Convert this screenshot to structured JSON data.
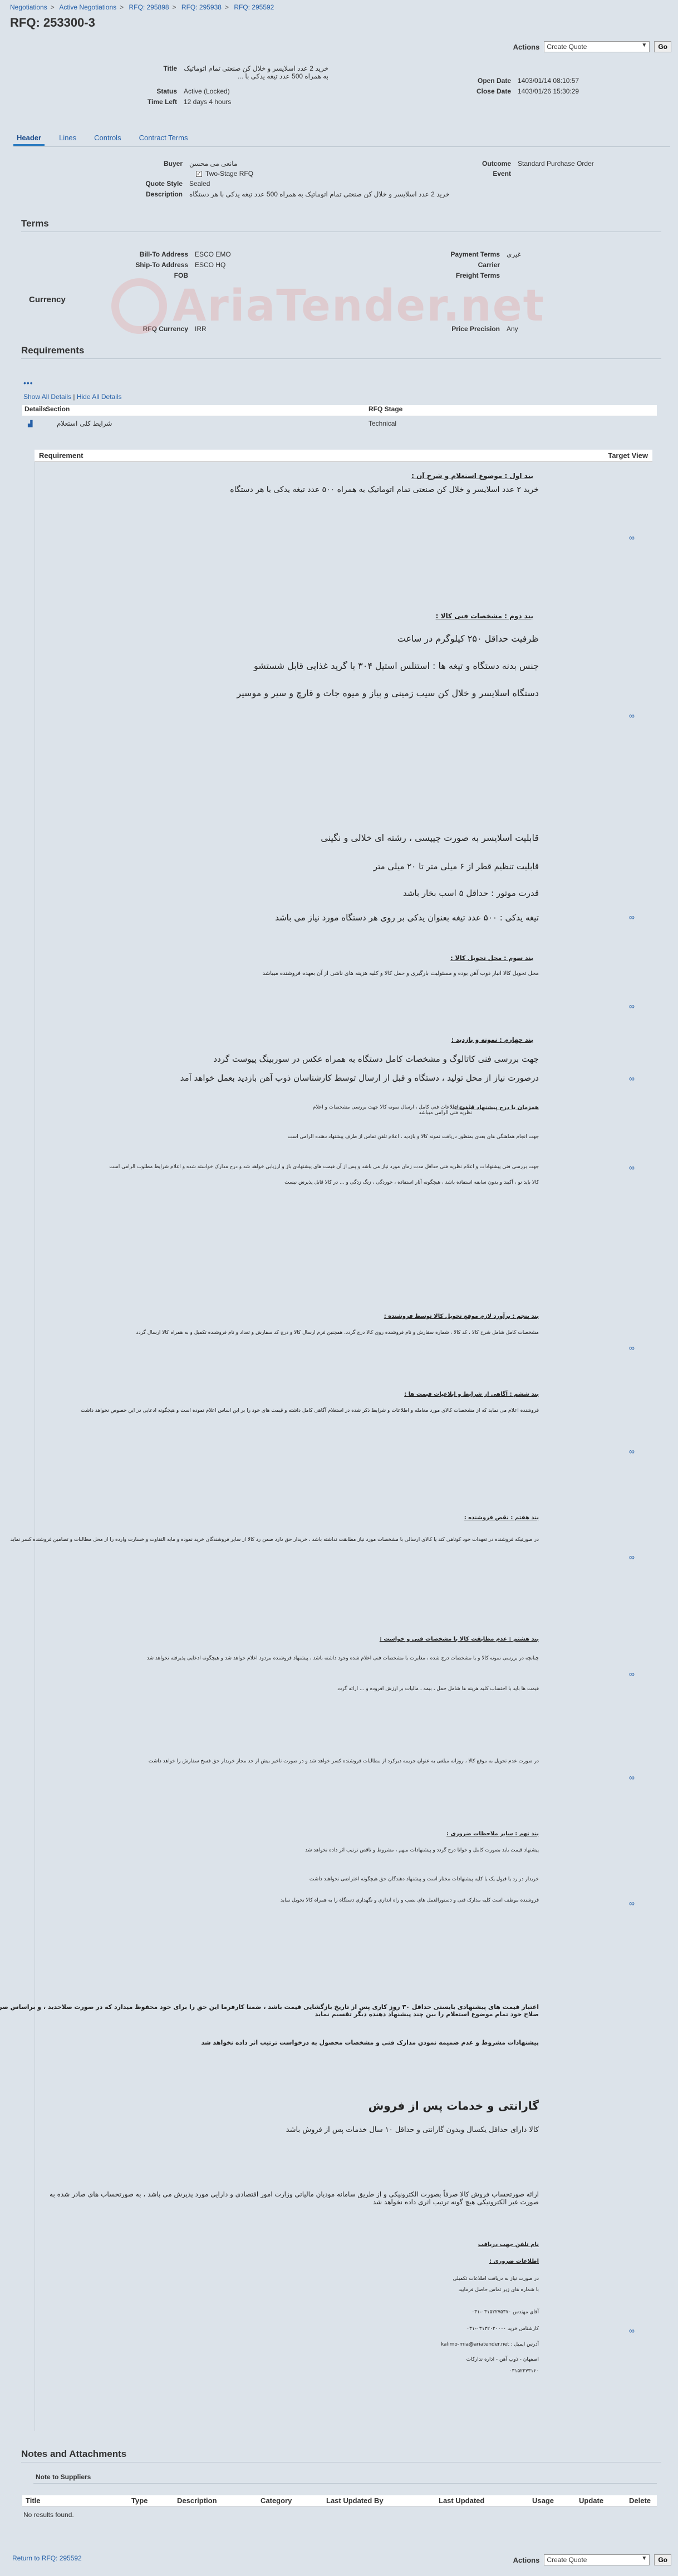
{
  "breadcrumb": [
    "Negotiations",
    "Active Negotiations",
    "RFQ: 295898",
    "RFQ: 295938",
    "RFQ: 295592"
  ],
  "page_title": "RFQ: 253300-3",
  "actions": {
    "label": "Actions",
    "selected": "Create Quote",
    "go": "Go"
  },
  "header": {
    "title_label": "Title",
    "title_value": "خرید 2 عدد اسلایسر و خلال کن صنعتی تمام اتوماتیک به همراه 500 عدد تیغه یدکی با ...",
    "status_label": "Status",
    "status_value": "Active (Locked)",
    "time_left_label": "Time Left",
    "time_left_value": "12 days 4 hours",
    "open_date_label": "Open Date",
    "open_date_value": "1403/01/14 08:10:57",
    "close_date_label": "Close Date",
    "close_date_value": "1403/01/26 15:30:29"
  },
  "tabs": [
    "Header",
    "Lines",
    "Controls",
    "Contract Terms"
  ],
  "header_tab": {
    "buyer_label": "Buyer",
    "buyer_value": "مانعی می محسن",
    "two_stage_label": "Two-Stage RFQ",
    "quote_style_label": "Quote Style",
    "quote_style_value": "Sealed",
    "description_label": "Description",
    "description_value": "خرید 2 عدد اسلایسر و خلال کن صنعتی تمام اتوماتیک به همراه 500 عدد تیغه یدکی با هر دستگاه",
    "outcome_label": "Outcome",
    "outcome_value": "Standard Purchase Order",
    "event_label": "Event"
  },
  "terms": {
    "heading": "Terms",
    "bill_to_label": "Bill-To Address",
    "bill_to_value": "ESCO EMO",
    "ship_to_label": "Ship-To Address",
    "ship_to_value": "ESCO HQ",
    "fob_label": "FOB",
    "payment_label": "Payment Terms",
    "payment_value": "غیری",
    "carrier_label": "Carrier",
    "freight_label": "Freight Terms"
  },
  "currency": {
    "heading": "Currency",
    "rfq_currency_label": "RFQ Currency",
    "rfq_currency_value": "IRR",
    "price_precision_label": "Price Precision",
    "price_precision_value": "Any"
  },
  "watermark": "AriaTender.net",
  "requirements": {
    "heading": "Requirements",
    "show_all": "Show All Details",
    "hide_all": "Hide All Details",
    "cols": [
      "Details",
      "Section",
      "RFQ Stage"
    ],
    "row": {
      "section": "شرایط کلی استعلام",
      "stage": "Technical"
    },
    "inner_cols": [
      "Requirement",
      "Target View"
    ]
  },
  "req_text": {
    "b1_h": "بند اول : موضوع استعلام و شرح آن :",
    "b1_1": "خرید ۲ عدد اسلایسر و خلال کن صنعتی تمام اتوماتیک به همراه ۵۰۰ عدد تیغه یدکی با هر دستگاه",
    "b2_h": "بند دوم : مشخصات فنی کالا :",
    "b2_1": "ظرفیت حداقل ۲۵۰ کیلوگرم در ساعت",
    "b2_2": "جنس بدنه دستگاه و تیغه ها : استنلس استیل ۳۰۴ با گرید غذایی قابل شستشو",
    "b2_3": "دستگاه اسلایسر و خلال کن سیب زمینی و پیاز و میوه جات و قارچ و سیر و موسیر",
    "b2_4": "قابلیت اسلایسر به صورت چیپسی ، رشته ای خلالی و نگینی",
    "b2_5": "قابلیت تنظیم قطر از ۶ میلی متر تا ۲۰ میلی متر",
    "b2_6": "قدرت موتور : حداقل ۵ اسب بخار باشد",
    "b2_7": "تیغه یدکی : ۵۰۰ عدد تیغه بعنوان یدکی بر روی هر دستگاه مورد نیاز می باشد",
    "b3_h": "بند سوم : محل تحویل کالا :",
    "b3_1": "محل تحویل کالا انبار ذوب آهن بوده و مسئولیت بارگیری و حمل کالا و کلیه هزینه های ناشی از آن بعهده فروشنده میباشد",
    "b4_h": "بند چهارم : نمونه و بازدید :",
    "b4_1": "جهت بررسی فنی کاتالوگ و مشخصات کامل دستگاه به همراه عکس در سوربینگ پیوست گردد",
    "b4_2": "درصورت نیاز از محل تولید ، دستگاه و قبل از ارسال توسط کارشناسان ذوب آهن بازدید بعمل خواهد آمد",
    "b5_h": "همزمان با درج پیشنهاد قیمت :",
    "b5_1": "با درج اطلاعات فنی کامل ، ارسال نمونه کالا جهت بررسی مشخصات و اعلام نظریه فنی الزامی میباشد",
    "b5_2": "جهت انجام هماهنگی های بعدی بمنظور دریافت نمونه کالا و بازدید ، اعلام تلفن تماس از طرف پیشنهاد دهنده الزامی است",
    "b5_3": "جهت بررسی فنی پیشنهادات و اعلام نظریه فنی حداقل مدت زمان مورد نیاز می باشد و پس از آن قیمت های پیشنهادی باز و ارزیابی خواهد شد و درج مدارک خواسته شده و اعلام شرایط مطلوب الزامی است",
    "b5_4": "کالا باید نو ، آکبند و بدون سابقه استفاده باشد ، هیچگونه آثار استفاده ، خوردگی ، زنگ زدگی و ... در کالا قابل پذیرش نیست",
    "b6_h": "بند پنجم : برآورد لازم موقع تحویل کالا توسط فروشنده :",
    "b6_1": "مشخصات کامل شامل شرح کالا ، کد کالا ، شماره سفارش و نام فروشنده روی کالا درج گردد. همچنین فرم ارسال کالا و درج کد سفارش و تعداد و نام فروشنده تکمیل و به همراه کالا ارسال گردد",
    "b7_h": "بند ششم : آگاهی از شرایط و ابلاغیات قیمت ها :",
    "b7_1": "فروشنده اعلام می نماید که از مشخصات کالای مورد معامله و اطلاعات و شرایط ذکر شده در استعلام آگاهی کامل داشته و قیمت های خود را بر این اساس اعلام نموده است و هیچگونه ادعایی در این خصوص نخواهد داشت",
    "b8_h": "بند هفتم : نقض فروشنده :",
    "b8_1": "در صورتیکه فروشنده در تعهدات خود کوتاهی کند یا کالای ارسالی با مشخصات مورد نیاز مطابقت نداشته باشد ، خریدار حق دارد ضمن رد کالا از سایر فروشندگان خرید نموده و مابه التفاوت و خسارت وارده را از محل مطالبات و تضامین فروشنده کسر نماید",
    "b9_h": "بند هشتم : عدم مطابقت کالا با مشخصات فنی و خواست :",
    "b9_1": "چنانچه در بررسی نمونه کالا و یا مشخصات درج شده ، مغایرت با مشخصات فنی اعلام شده وجود داشته باشد ، پیشنهاد فروشنده مردود اعلام خواهد شد و هیچگونه ادعایی پذیرفته نخواهد شد",
    "b9_2": "قیمت ها باید با احتساب کلیه هزینه ها شامل حمل ، بیمه ، مالیات بر ارزش افزوده و ... ارائه گردد",
    "b10_1": "در صورت عدم تحویل به موقع کالا ، روزانه مبلغی به عنوان جریمه دیرکرد از مطالبات فروشنده کسر خواهد شد و در صورت تاخیر بیش از حد مجاز خریدار حق فسخ سفارش را خواهد داشت",
    "b11_h": "بند نهم : سایر ملاحظات ضروری :",
    "b11_1": "پیشنهاد قیمت باید بصورت کامل و خوانا درج گردد و پیشنهادات مبهم ، مشروط و ناقص ترتیب اثر داده نخواهد شد",
    "b11_2": "خریدار در رد یا قبول یک یا کلیه پیشنهادات مختار است و پیشنهاد دهندگان حق هیچگونه اعتراضی نخواهند داشت",
    "b11_3": "فروشنده موظف است کلیه مدارک فنی و دستورالعمل های نصب و راه اندازی و نگهداری دستگاه را به همراه کالا تحویل نماید",
    "b12_1": "اعتبار قیمت های پیشنهادی بایستی حداقل ۳۰ روز کاری پس از تاریخ بازگشایی قیمت باشد ، ضمنا کارفرما این حق را برای خود محفوظ میدارد که در صورت صلاحدید ، و براساس صرفه و صلاح خود تمام موضوع استعلام را بین چند پیشنهاد دهنده دیگر تقسیم نماید",
    "b12_2": "پیشنهادات مشروط و عدم ضمیمه نمودن مدارک فنی و مشخصات محصول به درخواست ترتیب اثر داده نخواهد شد",
    "g_h": "گارانتی و خدمات پس از فروش",
    "g_1": "کالا دارای حداقل یکسال وبدون گارانتی و حداقل ۱۰ سال خدمات پس از فروش باشد",
    "g_2": "ارائه صورتحساب فروش کالا صرفاً بصورت الکترونیکی و از طریق سامانه مودیان مالیاتی وزارت امور اقتصادی و دارایی مورد پذیرش می باشد ، به صورتحساب های صادر شده به صورت غیر الکترونیکی هیچ گونه ترتیب اثری داده نخواهد شد",
    "c_h": "نام تلفن جهت دریافت",
    "c_h2": "اطلاعات ضروری :",
    "c_1": "در صورت نیاز به دریافت اطلاعات تکمیلی",
    "c_2": "با شماره های زیر تماس حاصل فرمایید",
    "c_3": "آقای مهندس ۰۳۱۵۲۲۷۵۳۷۰-۰۳۱",
    "c_4": "کارشناس خرید ۰۳۱۳۲۰۲۰۰۰۰-۰۳۱",
    "c_5": "آدرس ایمیل : kalimo-mia@ariatender.net",
    "c_6": "اصفهان - ذوب آهن - اداره تدارکات",
    "c_7": "۰۳۱۵۲۲۷۳۱۶۰",
    "target_view_icon": "∞"
  },
  "notes": {
    "heading": "Notes and Attachments",
    "note_to_suppliers": "Note to Suppliers",
    "cols": [
      "Title",
      "Type",
      "Description",
      "Category",
      "Last Updated By",
      "Last Updated",
      "Usage",
      "Update",
      "Delete"
    ],
    "empty": "No results found."
  },
  "return_link": "Return to RFQ: 295592"
}
